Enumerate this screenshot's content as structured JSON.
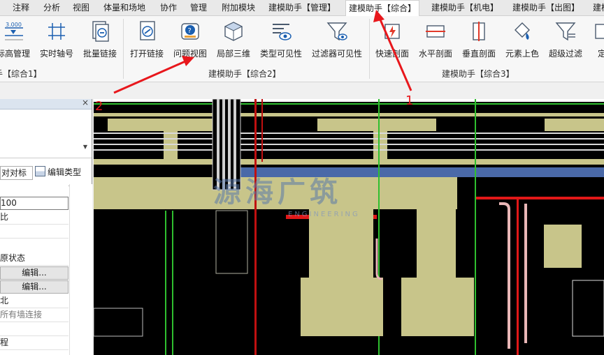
{
  "tabs": [
    "注释",
    "分析",
    "视图",
    "体量和场地",
    "协作",
    "管理",
    "附加模块",
    "建模助手【管理】",
    "建模助手【综合】",
    "建模助手【机电】",
    "建模助手【出图】",
    "建模"
  ],
  "active_tab_index": 8,
  "ribbon": {
    "group1": {
      "label": "手【综合1】",
      "tools": [
        {
          "label": "标高管理",
          "icon": "level-icon",
          "badge": "3.000"
        },
        {
          "label": "实时轴号",
          "icon": "axis-icon"
        },
        {
          "label": "批量链接",
          "icon": "batch-link-icon"
        }
      ]
    },
    "group2": {
      "label": "建模助手【综合2】",
      "tools": [
        {
          "label": "打开链接",
          "icon": "open-link-icon"
        },
        {
          "label": "问题视图",
          "icon": "issue-view-icon"
        },
        {
          "label": "局部三维",
          "icon": "local-3d-icon"
        },
        {
          "label": "类型可见性",
          "icon": "type-visibility-icon"
        },
        {
          "label": "过滤器可见性",
          "icon": "filter-visibility-icon"
        }
      ]
    },
    "group3": {
      "label": "建模助手【综合3】",
      "tools": [
        {
          "label": "快速剖面",
          "icon": "quick-section-icon"
        },
        {
          "label": "水平剖面",
          "icon": "horizontal-section-icon"
        },
        {
          "label": "垂直剖面",
          "icon": "vertical-section-icon"
        },
        {
          "label": "元素上色",
          "icon": "color-element-icon"
        },
        {
          "label": "超级过滤",
          "icon": "super-filter-icon"
        },
        {
          "label": "定",
          "icon": "partial-icon"
        }
      ]
    }
  },
  "properties": {
    "close_glyph": "×",
    "select_value": "对对标",
    "edit_type_label": "编辑类型",
    "collapse_glyph": "^",
    "rows": [
      {
        "text": "100",
        "kind": "input"
      },
      {
        "text": "比",
        "kind": "plain"
      },
      {
        "text": "",
        "kind": "plain"
      },
      {
        "text": "原状态",
        "kind": "plain"
      },
      {
        "text": "编辑...",
        "kind": "btn"
      },
      {
        "text": "编辑...",
        "kind": "btn"
      },
      {
        "text": "北",
        "kind": "plain"
      },
      {
        "text": "所有墙连接",
        "kind": "grey"
      },
      {
        "text": "",
        "kind": "plain"
      },
      {
        "text": "程",
        "kind": "plain"
      }
    ]
  },
  "annotations": {
    "one": "1",
    "two": "2"
  },
  "watermark": {
    "main": "源海广筑",
    "sub": "ENGINEERING"
  },
  "colors": {
    "accent": "#e8171c",
    "pipe": "#c8c58a",
    "canvas": "#000000"
  }
}
